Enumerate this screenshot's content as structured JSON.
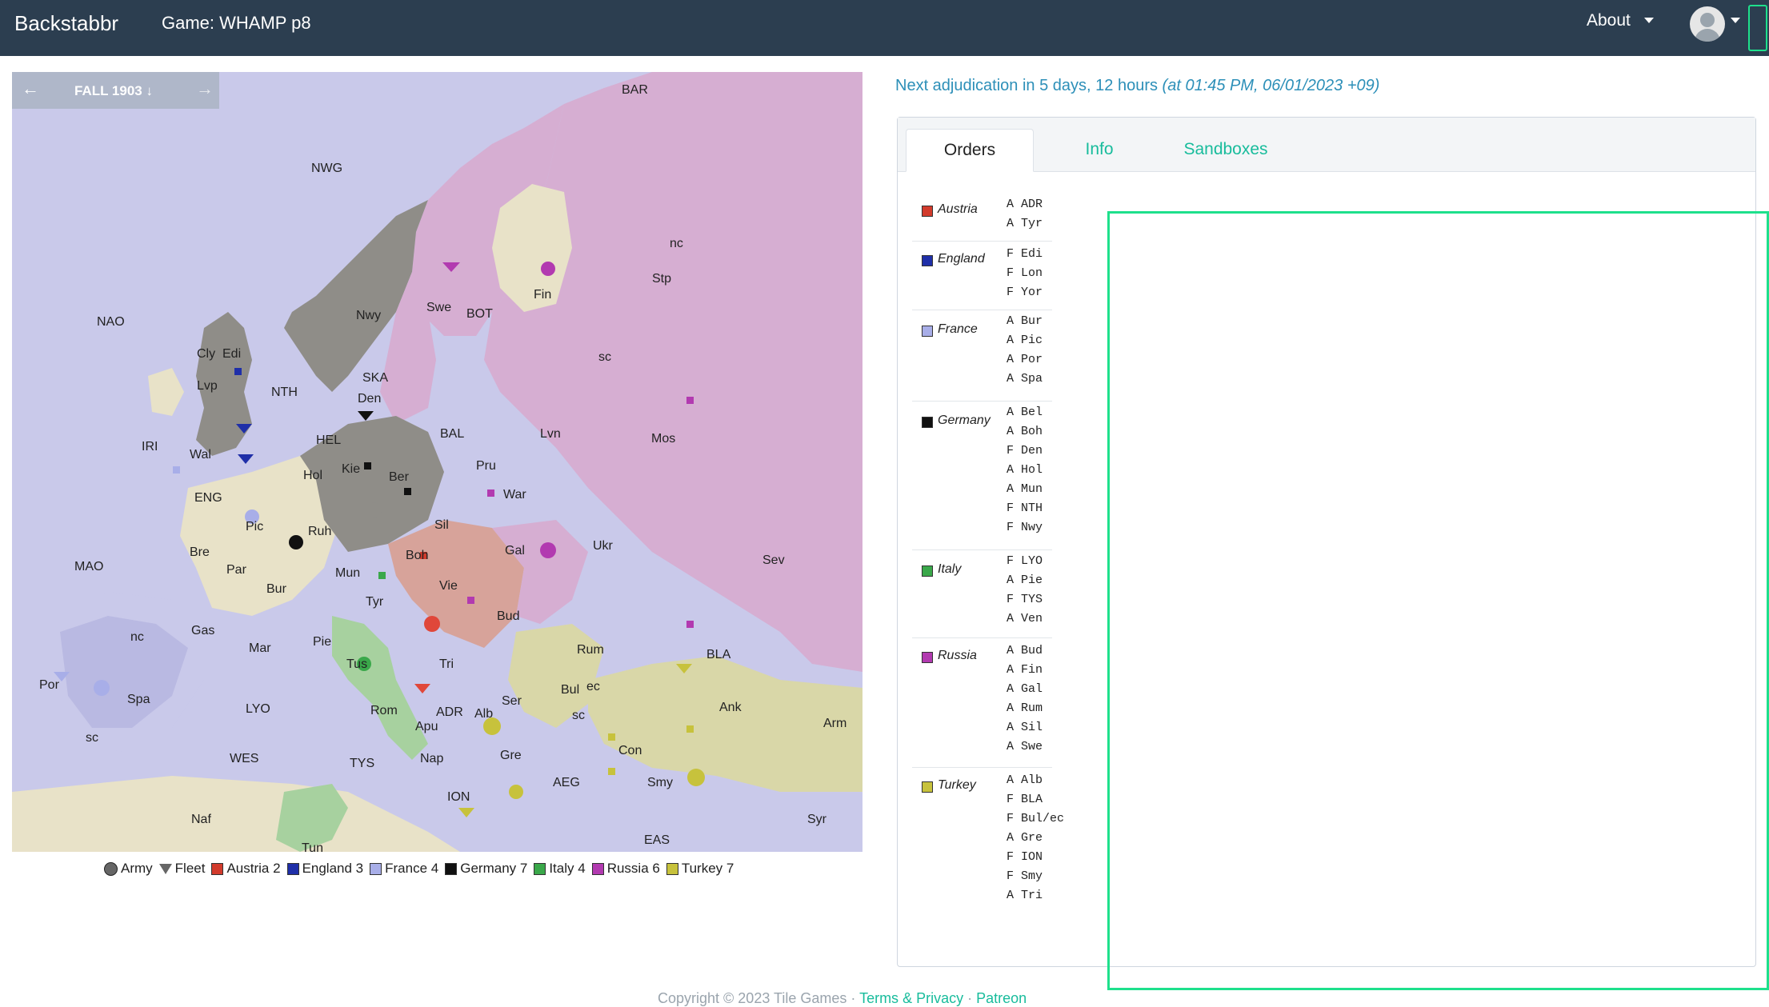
{
  "navbar": {
    "brand": "Backstabbr",
    "game": "Game: WHAMP p8",
    "about": "About"
  },
  "map": {
    "phase": "FALL 1903 ↓",
    "prev_arrow": "←",
    "next_arrow": "→",
    "provinces": [
      {
        "label": "BAR"
      },
      {
        "label": "NWG"
      },
      {
        "label": "nc"
      },
      {
        "label": "Stp"
      },
      {
        "label": "Fin"
      },
      {
        "label": "NAO"
      },
      {
        "label": "Nwy"
      },
      {
        "label": "Swe"
      },
      {
        "label": "BOT"
      },
      {
        "label": "sc"
      },
      {
        "label": "Cly"
      },
      {
        "label": "Edi"
      },
      {
        "label": "Lvp"
      },
      {
        "label": "NTH"
      },
      {
        "label": "SKA"
      },
      {
        "label": "Den"
      },
      {
        "label": "BAL"
      },
      {
        "label": "Lvn"
      },
      {
        "label": "Mos"
      },
      {
        "label": "IRI"
      },
      {
        "label": "Wal"
      },
      {
        "label": "HEL"
      },
      {
        "label": "Hol"
      },
      {
        "label": "Kie"
      },
      {
        "label": "Ber"
      },
      {
        "label": "Pru"
      },
      {
        "label": "War"
      },
      {
        "label": "ENG"
      },
      {
        "label": "Ruh"
      },
      {
        "label": "Sil"
      },
      {
        "label": "Pic"
      },
      {
        "label": "Bre"
      },
      {
        "label": "Par"
      },
      {
        "label": "Bur"
      },
      {
        "label": "Mun"
      },
      {
        "label": "Boh"
      },
      {
        "label": "Gal"
      },
      {
        "label": "Ukr"
      },
      {
        "label": "Sev"
      },
      {
        "label": "MAO"
      },
      {
        "label": "Tyr"
      },
      {
        "label": "Vie"
      },
      {
        "label": "Bud"
      },
      {
        "label": "Gas"
      },
      {
        "label": "Mar"
      },
      {
        "label": "Pie"
      },
      {
        "label": "Rum"
      },
      {
        "label": "BLA"
      },
      {
        "label": "Por"
      },
      {
        "label": "Spa"
      },
      {
        "label": "Tus"
      },
      {
        "label": "Tri"
      },
      {
        "label": "Bul"
      },
      {
        "label": "ec"
      },
      {
        "label": "sc"
      },
      {
        "label": "LYO"
      },
      {
        "label": "Rom"
      },
      {
        "label": "ADR"
      },
      {
        "label": "Alb"
      },
      {
        "label": "Ser"
      },
      {
        "label": "Ank"
      },
      {
        "label": "Arm"
      },
      {
        "label": "Apu"
      },
      {
        "label": "Nap"
      },
      {
        "label": "WES"
      },
      {
        "label": "TYS"
      },
      {
        "label": "Gre"
      },
      {
        "label": "Con"
      },
      {
        "label": "AEG"
      },
      {
        "label": "Smy"
      },
      {
        "label": "ION"
      },
      {
        "label": "Naf"
      },
      {
        "label": "Tun"
      },
      {
        "label": "EAS"
      },
      {
        "label": "Syr"
      },
      {
        "label": "nc"
      },
      {
        "label": "sc"
      }
    ],
    "legend": [
      {
        "label": "Army",
        "kind": "army"
      },
      {
        "label": "Fleet",
        "kind": "fleet"
      },
      {
        "label": "Austria 2",
        "color": "#d23b2c"
      },
      {
        "label": "England 3",
        "color": "#1f2fa8"
      },
      {
        "label": "France 4",
        "color": "#a8aee8"
      },
      {
        "label": "Germany 7",
        "color": "#111111"
      },
      {
        "label": "Italy 4",
        "color": "#3aa84a"
      },
      {
        "label": "Russia 6",
        "color": "#b23ab0"
      },
      {
        "label": "Turkey 7",
        "color": "#c7c23c"
      }
    ]
  },
  "adjudication": {
    "prefix": "Next adjudication in 5 days, 12 hours ",
    "when": "(at 01:45 PM, 06/01/2023 +09)"
  },
  "tabs": [
    {
      "label": "Orders"
    },
    {
      "label": "Info"
    },
    {
      "label": "Sandboxes"
    }
  ],
  "nations": [
    {
      "name": "Austria",
      "color": "#d23b2c",
      "orders": [
        "A ADR",
        "A Tyr"
      ]
    },
    {
      "name": "England",
      "color": "#1f2fa8",
      "orders": [
        "F Edi",
        "F Lon",
        "F Yor"
      ]
    },
    {
      "name": "France",
      "color": "#a8aee8",
      "orders": [
        "A Bur",
        "A Pic",
        "A Por",
        "A Spa"
      ]
    },
    {
      "name": "Germany",
      "color": "#111111",
      "orders": [
        "A Bel",
        "A Boh",
        "F Den",
        "A Hol",
        "A Mun",
        "F NTH",
        "F Nwy"
      ]
    },
    {
      "name": "Italy",
      "color": "#3aa84a",
      "orders": [
        "F LYO",
        "A Pie",
        "F TYS",
        "A Ven"
      ]
    },
    {
      "name": "Russia",
      "color": "#b23ab0",
      "orders": [
        "A Bud",
        "A Fin",
        "A Gal",
        "A Rum",
        "A Sil",
        "A Swe"
      ]
    },
    {
      "name": "Turkey",
      "color": "#c7c23c",
      "orders": [
        "A Alb",
        "F BLA",
        "F Bul/ec",
        "A Gre",
        "F ION",
        "F Smy",
        "A Tri"
      ]
    }
  ],
  "footer": {
    "copyright": "Copyright © 2023 Tile Games ·",
    "terms": "Terms & Privacy",
    "sep": "·",
    "patreon": "Patreon"
  }
}
